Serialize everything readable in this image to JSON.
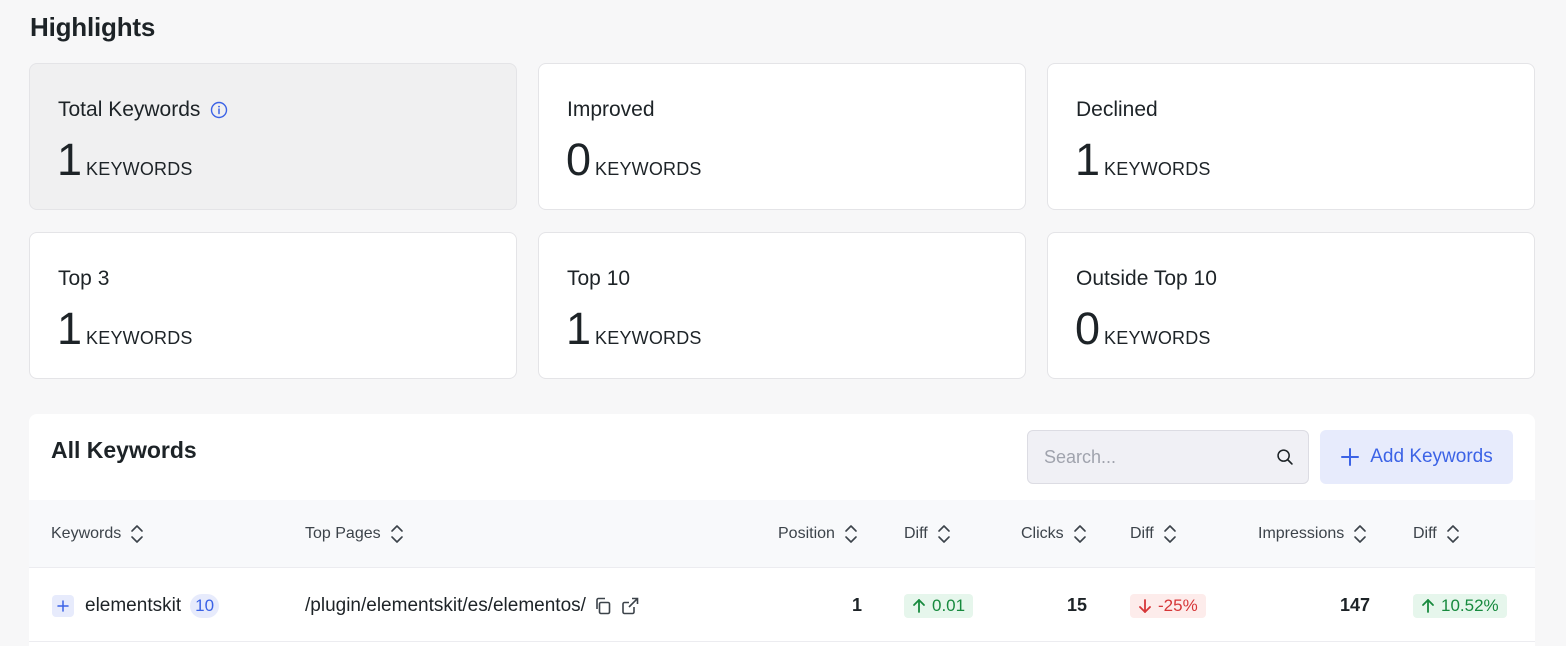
{
  "page": {
    "title": "Highlights"
  },
  "cards": [
    {
      "title": "Total Keywords",
      "value": "1",
      "unit": "KEYWORDS",
      "has_info": true
    },
    {
      "title": "Improved",
      "value": "0",
      "unit": "KEYWORDS"
    },
    {
      "title": "Declined",
      "value": "1",
      "unit": "KEYWORDS"
    },
    {
      "title": "Top 3",
      "value": "1",
      "unit": "KEYWORDS"
    },
    {
      "title": "Top 10",
      "value": "1",
      "unit": "KEYWORDS"
    },
    {
      "title": "Outside Top 10",
      "value": "0",
      "unit": "KEYWORDS"
    }
  ],
  "keywords_panel": {
    "title": "All Keywords",
    "search_placeholder": "Search...",
    "add_button_label": "Add Keywords",
    "columns": [
      "Keywords",
      "Top Pages",
      "Position",
      "Diff",
      "Clicks",
      "Diff",
      "Impressions",
      "Diff"
    ],
    "rows": [
      {
        "keyword": "elementskit",
        "keyword_count": "10",
        "top_page": "/plugin/elementskit/es/elementos/",
        "position": "1",
        "position_diff": "0.01",
        "clicks": "15",
        "clicks_diff": "-25%",
        "impressions": "147",
        "impressions_diff": "10.52%"
      }
    ]
  },
  "colors": {
    "accent": "#3c63e6",
    "positive": "#178a3e",
    "negative": "#d63638"
  },
  "icons": [
    "info-icon",
    "search-icon",
    "plus-icon",
    "sort-icon",
    "copy-icon",
    "external-link-icon",
    "arrow-up-icon",
    "arrow-down-icon"
  ]
}
